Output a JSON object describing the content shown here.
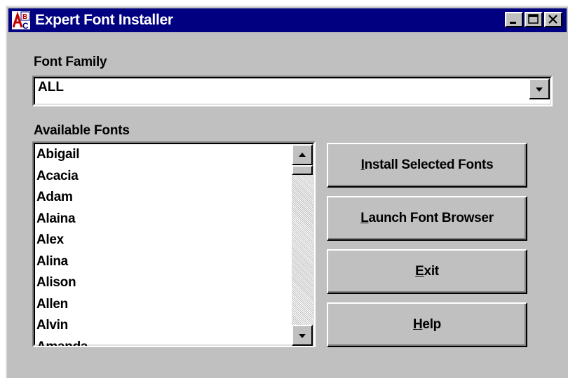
{
  "window": {
    "title": "Expert Font Installer",
    "icon": "font-installer-app-icon",
    "controls": {
      "minimize": "minimize-icon",
      "maximize": "maximize-icon",
      "close": "close-icon"
    }
  },
  "font_family": {
    "label": "Font Family",
    "value": "ALL"
  },
  "available_fonts": {
    "label": "Available Fonts",
    "items": [
      "Abigail",
      "Acacia",
      "Adam",
      "Alaina",
      "Alex",
      "Alina",
      "Alison",
      "Allen",
      "Alvin",
      "Amanda"
    ]
  },
  "buttons": {
    "install": {
      "mnemonic": "I",
      "rest": "nstall Selected Fonts"
    },
    "launch": {
      "mnemonic": "L",
      "rest": "aunch Font Browser"
    },
    "exit": {
      "mnemonic": "E",
      "rest": "xit"
    },
    "help": {
      "mnemonic": "H",
      "rest": "elp"
    }
  },
  "colors": {
    "titlebar": "#000080",
    "face": "#c0c0c0"
  }
}
